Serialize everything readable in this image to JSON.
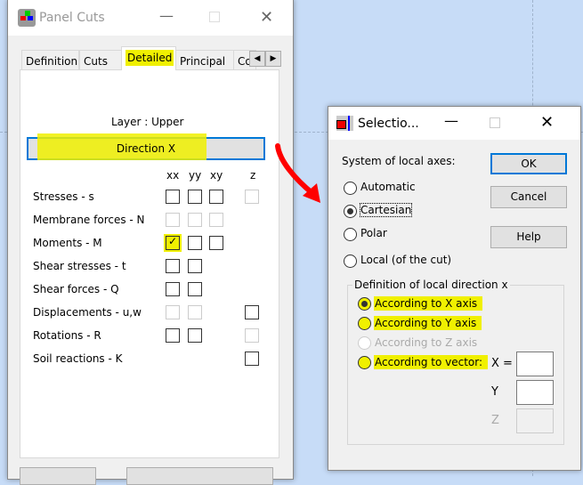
{
  "panel_cuts": {
    "title": "Panel Cuts",
    "tabs": [
      {
        "label": "Definition",
        "active": false
      },
      {
        "label": "Cuts",
        "active": false
      },
      {
        "label": "Detailed",
        "active": true
      },
      {
        "label": "Principal",
        "active": false
      },
      {
        "label": "Co",
        "active": false
      }
    ],
    "layer_label": "Layer : Upper",
    "direction_button": "Direction X",
    "columns": [
      "xx",
      "yy",
      "xy",
      "z"
    ],
    "rows": [
      {
        "label": "Stresses - s",
        "xx": "off",
        "yy": "off",
        "xy": "off",
        "z": "disabled"
      },
      {
        "label": "Membrane forces - N",
        "xx": "disabled",
        "yy": "disabled",
        "xy": "disabled",
        "z": null
      },
      {
        "label": "Moments - M",
        "xx": "checked",
        "yy": "off",
        "xy": "off",
        "z": null
      },
      {
        "label": "Shear stresses - t",
        "xx": "off",
        "yy": "off",
        "xy": null,
        "z": null
      },
      {
        "label": "Shear forces - Q",
        "xx": "off",
        "yy": "off",
        "xy": null,
        "z": null
      },
      {
        "label": "Displacements - u,w",
        "xx": "disabled",
        "yy": "disabled",
        "xy": null,
        "z": "off"
      },
      {
        "label": "Rotations - R",
        "xx": "off",
        "yy": "off",
        "xy": null,
        "z": "disabled"
      },
      {
        "label": "Soil reactions - K",
        "xx": null,
        "yy": null,
        "xy": null,
        "z": "off"
      }
    ]
  },
  "selection": {
    "title": "Selectio...",
    "system_label": "System of local axes:",
    "axes_options": [
      {
        "label": "Automatic",
        "selected": false
      },
      {
        "label": "Cartesian",
        "selected": true
      },
      {
        "label": "Polar",
        "selected": false
      },
      {
        "label": "Local (of the cut)",
        "selected": false
      }
    ],
    "ok": "OK",
    "cancel": "Cancel",
    "help": "Help",
    "group_label": "Definition of local direction x",
    "direction_options": [
      {
        "label": "According to X axis",
        "selected": true,
        "enabled": true
      },
      {
        "label": "According to Y axis",
        "selected": false,
        "enabled": true
      },
      {
        "label": "According to Z axis",
        "selected": false,
        "enabled": false
      },
      {
        "label": "According to vector:",
        "selected": false,
        "enabled": true
      }
    ],
    "vector_labels": {
      "x": "X =",
      "y": "Y",
      "z": "Z"
    },
    "vector_values": {
      "x": "",
      "y": "",
      "z": ""
    }
  },
  "colors": {
    "highlight": "#f0f000",
    "arrow": "#ff0000",
    "focus": "#0078d7"
  }
}
